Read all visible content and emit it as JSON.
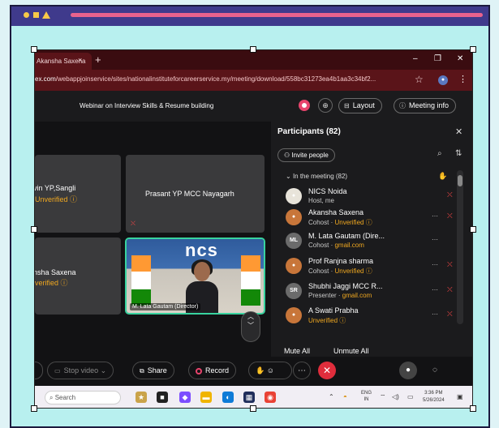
{
  "browser": {
    "tab_title": "Akansha Saxena",
    "tab_close": "×",
    "new_tab": "+",
    "url_domain": "ex.com",
    "url_path": "/webappjoinservice/sites/nationalinstituteforcareerservice.my/meeting/download/558bc31273ea4b1aa3c34bf2...",
    "window_controls": [
      "–",
      "❐",
      "✕"
    ]
  },
  "meeting": {
    "title": "Webinar on Interview Skills & Resume building",
    "layout_label": "Layout",
    "meeting_info_label": "Meeting info"
  },
  "tiles": [
    {
      "name": "vin YP,Sangli",
      "status": "Unverified ⓘ"
    },
    {
      "name": "Prasant YP MCC Nayagarh"
    },
    {
      "name": "nsha Saxena",
      "status": "verified ⓘ"
    },
    {
      "video_label": "M. Lata Gautam (Director)",
      "video_text": "ncs"
    }
  ],
  "participants": {
    "title": "Participants (82)",
    "invite_label": "Invite people",
    "section_label": "In the meeting (82)",
    "mute_all": "Mute All",
    "unmute_all": "Unmute All",
    "list": [
      {
        "initials": "",
        "name": "NICS Noida",
        "role": "Host, me",
        "status": "",
        "avatar_color": "#e8e4da"
      },
      {
        "initials": "",
        "name": "Akansha Saxena",
        "role": "Cohost",
        "status": "Unverified ⓘ",
        "avatar_color": "#c8763a"
      },
      {
        "initials": "ML",
        "name": "M. Lata Gautam (Dire...",
        "role": "Cohost",
        "status": "gmail.com",
        "avatar_color": "#6b6b6b"
      },
      {
        "initials": "",
        "name": "Prof Ranjna sharma",
        "role": "Cohost",
        "status": "Unverified ⓘ",
        "avatar_color": "#c8763a"
      },
      {
        "initials": "SR",
        "name": "Shubhi Jaggi MCC R...",
        "role": "Presenter",
        "status": "gmail.com",
        "avatar_color": "#6b6b6b"
      },
      {
        "initials": "",
        "name": "A Swati Prabha",
        "role": "",
        "status": "Unverified ⓘ",
        "avatar_color": "#c8763a"
      }
    ]
  },
  "controls": {
    "stop_video": "Stop video",
    "share": "Share",
    "record": "Record"
  },
  "taskbar": {
    "search_placeholder": "Search",
    "lang_line1": "ENG",
    "lang_line2": "IN",
    "time": "3:36 PM",
    "date": "5/26/2024"
  },
  "colors": {
    "accent_warn": "#f0a820",
    "end_call": "#e02d3c",
    "video_border": "#38d39f",
    "frame_header": "#3f3a8c",
    "frame_body": "#b8f0ef"
  }
}
